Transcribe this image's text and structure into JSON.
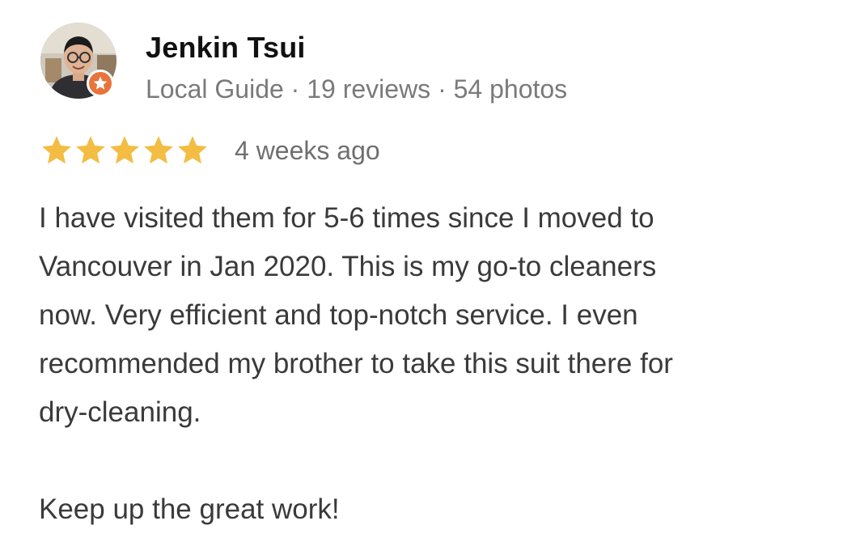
{
  "reviewer": {
    "name": "Jenkin Tsui",
    "meta": "Local Guide · 19 reviews · 54 photos",
    "avatar_icon": "user-avatar-photo",
    "badge_icon": "local-guide-star-icon",
    "badge_color": "#e8743b"
  },
  "rating": {
    "stars": 5,
    "max_stars": 5,
    "star_color": "#f2bd42",
    "date": "4 weeks ago"
  },
  "review": {
    "lines": [
      "I have visited them for 5-6 times since I moved to",
      "Vancouver in Jan 2020. This is my go-to cleaners",
      "now. Very efficient and top-notch service. I even",
      "recommended my brother to take this suit there for",
      "dry-cleaning."
    ],
    "closing": "Keep up the great work!"
  }
}
